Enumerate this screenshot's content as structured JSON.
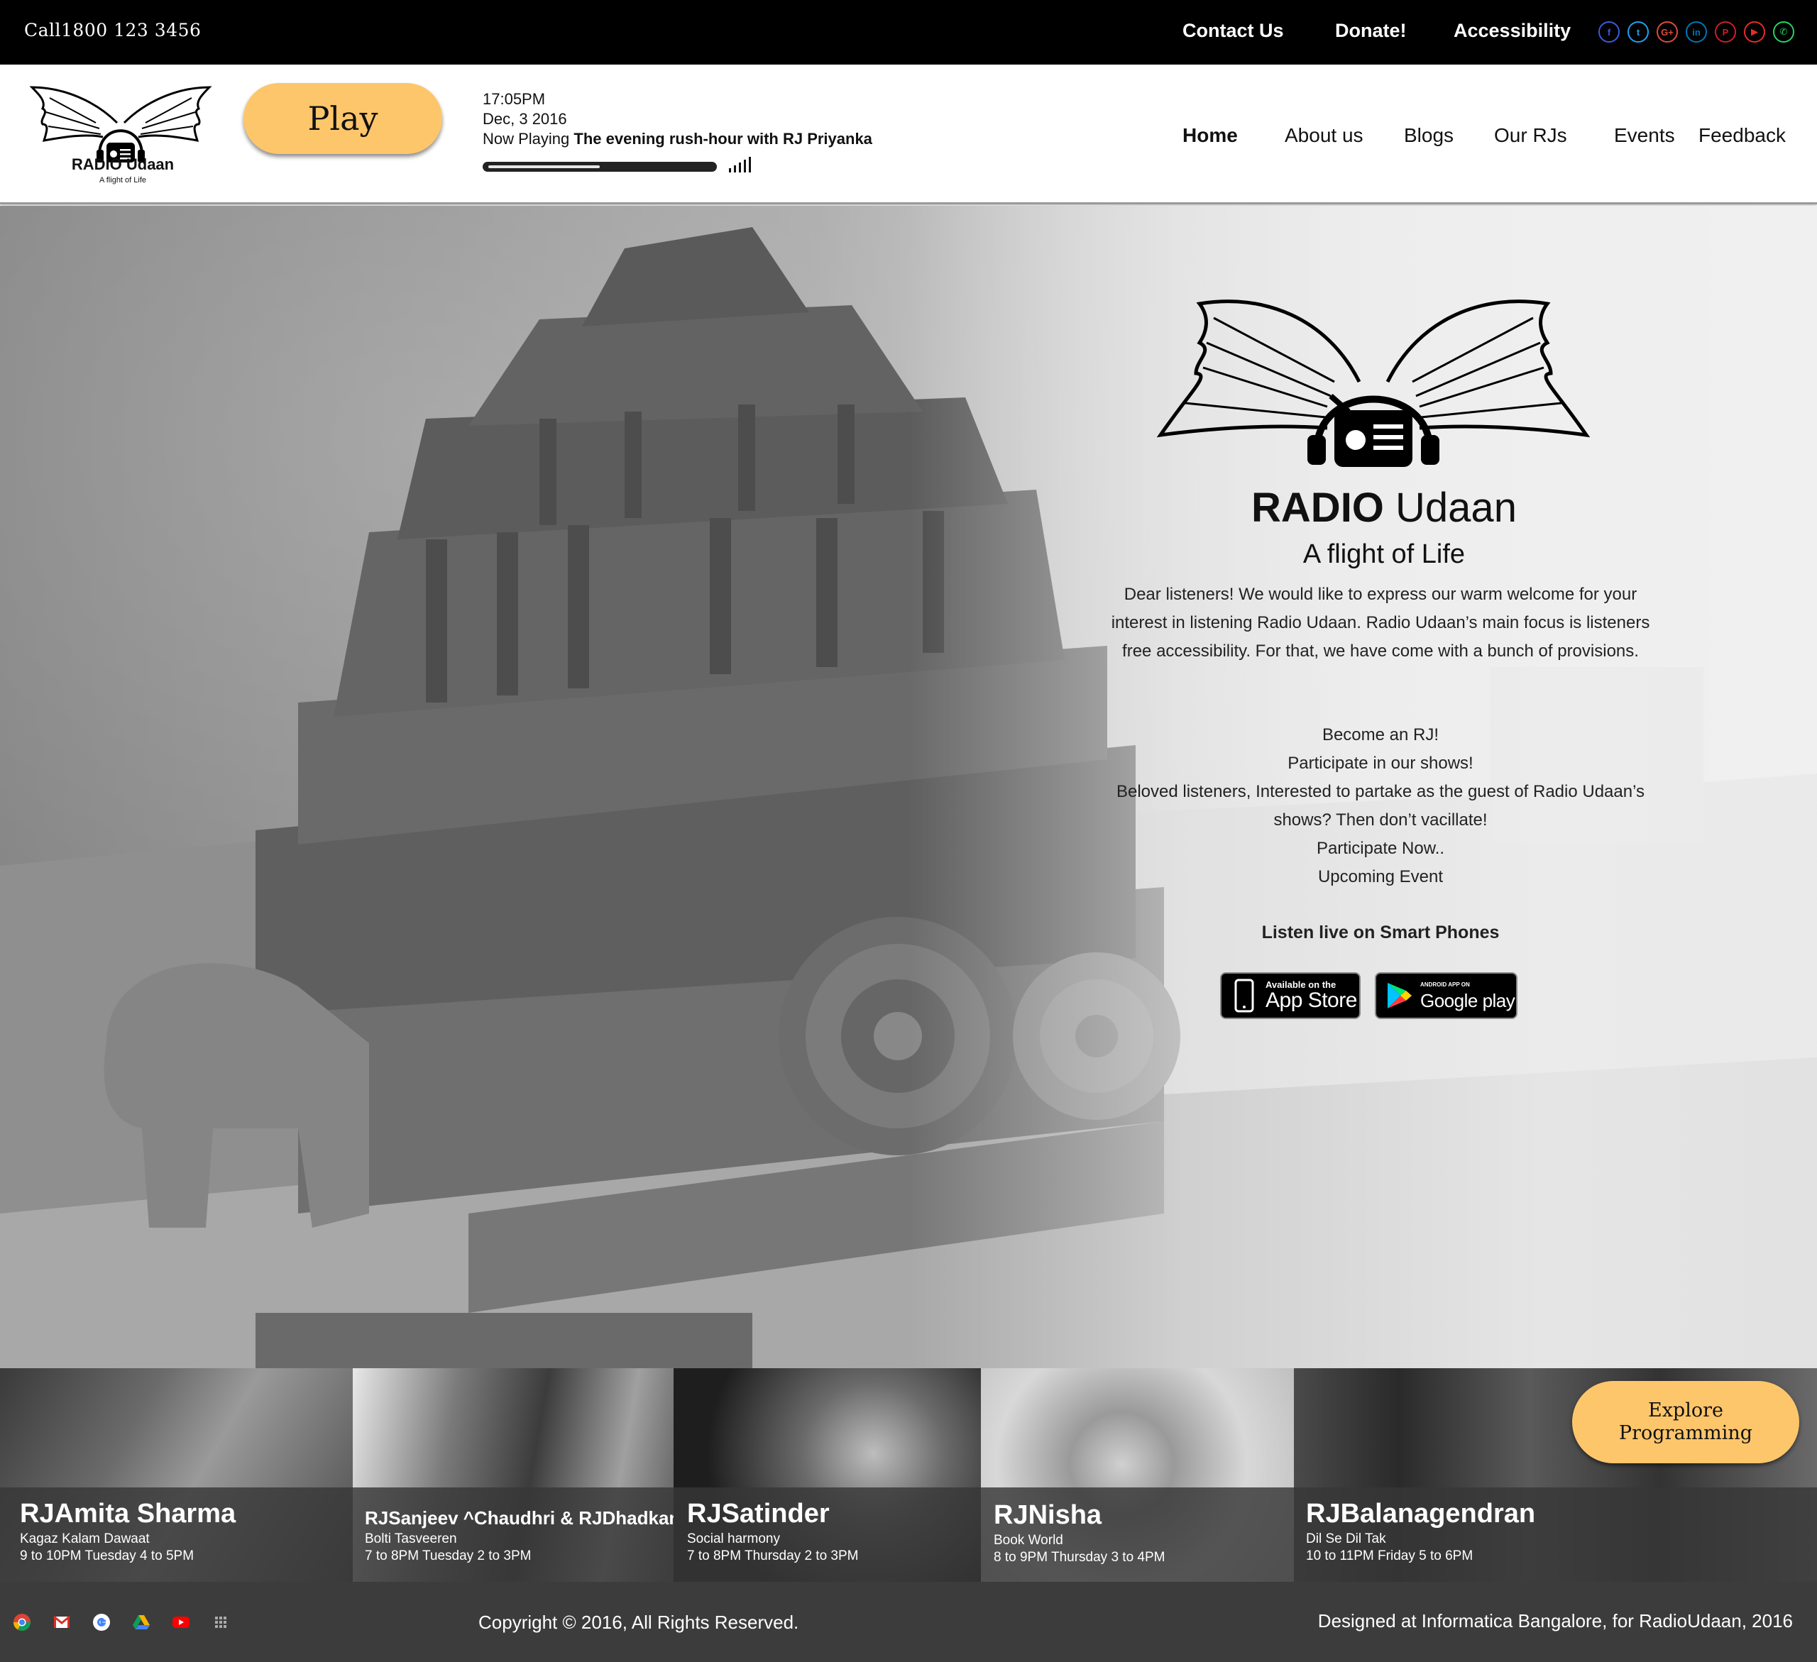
{
  "topbar": {
    "call": "Call1800 123 3456",
    "contact": "Contact Us",
    "donate": "Donate!",
    "accessibility": "Accessibility",
    "socials": [
      {
        "icon": "facebook-icon",
        "glyph": "f",
        "color": "#3b5bdb"
      },
      {
        "icon": "twitter-icon",
        "glyph": "t",
        "color": "#1da1f2"
      },
      {
        "icon": "google-plus-icon",
        "glyph": "G+",
        "color": "#dd4b39"
      },
      {
        "icon": "linkedin-icon",
        "glyph": "in",
        "color": "#0077b5"
      },
      {
        "icon": "pinterest-icon",
        "glyph": "P",
        "color": "#cb2027"
      },
      {
        "icon": "youtube-icon",
        "glyph": "▶",
        "color": "#e52d27"
      },
      {
        "icon": "whatsapp-icon",
        "glyph": "✆",
        "color": "#25d366"
      }
    ]
  },
  "header": {
    "logo_name": "RADIO Udaan",
    "logo_tagline": "A flight of Life",
    "play_label": "Play",
    "time": "17:05PM",
    "date": "Dec, 3 2016",
    "now_playing_label": "Now Playing ",
    "now_playing_title": "The evening rush-hour with RJ Priyanka",
    "progress": 0.5,
    "accent_color": "#fec66b"
  },
  "nav": {
    "home": "Home",
    "about": "About us",
    "blogs": "Blogs",
    "rjs": "Our RJs",
    "events": "Events",
    "feedback": "Feedback"
  },
  "hero": {
    "title_bold": "RADIO ",
    "title_regular": "Udaan",
    "subtitle": "A flight of Life",
    "body_line1": "Dear listeners! We would like to express our warm welcome for your",
    "body_line2": "interest in listening Radio Udaan. Radio Udaan’s main focus is listeners",
    "body_line3": "free accessibility. For that, we have come with a bunch of provisions.",
    "become_rj": "Become an RJ!",
    "participate": "Participate in our shows!",
    "beloved_line1": "Beloved listeners, Interested to partake as the guest of Radio Udaan’s",
    "beloved_line2": "shows? Then don’t vacillate!",
    "participate_now": "Participate Now..",
    "upcoming": "Upcoming  Event",
    "listen_live": "Listen live on Smart Phones",
    "appstore_small": "Available on the",
    "appstore_big": "App Store",
    "googleplay_small": "ANDROID APP ON",
    "googleplay_big": "Google play"
  },
  "rjs": [
    {
      "name": "RJAmita Sharma",
      "show": "Kagaz Kalam Dawaat",
      "time": "9 to 10PM    Tuesday 4 to 5PM"
    },
    {
      "name": "RJSanjeev ^Chaudhri & RJDhadkan",
      "show": "Bolti Tasveeren",
      "time": "7 to 8PM Tuesday 2 to 3PM"
    },
    {
      "name": "RJSatinder",
      "show": "Social harmony",
      "time": "7 to 8PM Thursday 2 to 3PM"
    },
    {
      "name": "RJNisha",
      "show": "Book World",
      "time": "8 to 9PM Thursday 3 to 4PM"
    },
    {
      "name": "RJBalanagendran",
      "show": "Dil Se Dil Tak",
      "time": "10 to 11PM   Friday 5 to 6PM"
    }
  ],
  "explore_line1": "Explore",
  "explore_line2": "Programming",
  "footer": {
    "icons": [
      "chrome-icon",
      "gmail-icon",
      "google-icon",
      "drive-icon",
      "youtube-icon",
      "apps-grid-icon"
    ],
    "copyright": "Copyright © 2016, All Rights Reserved.",
    "designed": "Designed at Informatica Bangalore, for  RadioUdaan, 2016"
  }
}
